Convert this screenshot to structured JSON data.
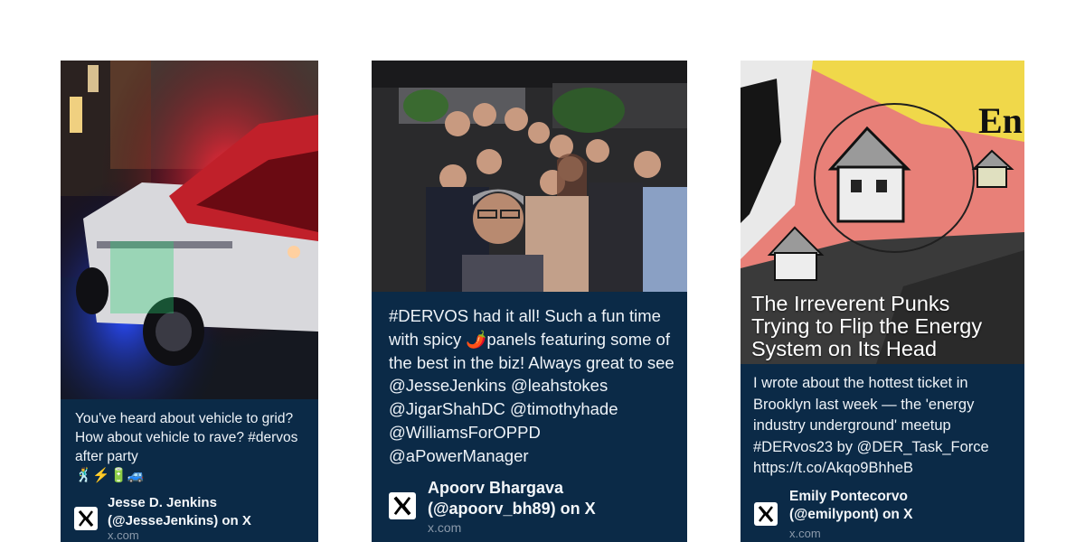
{
  "cards": [
    {
      "text": "You've heard about vehicle to grid? How about vehicle to rave? #dervos after party\n🕺⚡🔋🚙",
      "author": "Jesse D. Jenkins\n(@JesseJenkins) on X",
      "source": "x.com",
      "icon": "x-logo-icon",
      "photo": "truck-party-photo"
    },
    {
      "text": "#DERVOS had it all! Such a fun time with spicy 🌶️panels featuring some of the best in the biz! Always great to see @JesseJenkins @leahstokes @JigarShahDC @timothyhade @WilliamsForOPPD @aPowerManager",
      "author": "Apoorv Bhargava\n(@apoorv_bh89) on X",
      "source": "x.com",
      "icon": "x-logo-icon",
      "photo": "group-selfie-photo"
    },
    {
      "overlay_title": "The Irreverent Punks\nTrying to Flip the Energy\nSystem on Its Head",
      "overlay_letters": "En",
      "text": "I wrote about the hottest ticket in Brooklyn last week — the 'energy industry underground' meetup #DERvos23 by @DER_Task_Force https://t.co/Akqo9BhheB",
      "author": "Emily Pontecorvo\n(@emilypont) on X",
      "source": "x.com",
      "icon": "x-logo-icon",
      "photo": "houses-collage-image"
    }
  ],
  "colors": {
    "card_bg": "#0b2a47",
    "card_text": "#eef3f8",
    "source_text": "#8a99aa"
  }
}
